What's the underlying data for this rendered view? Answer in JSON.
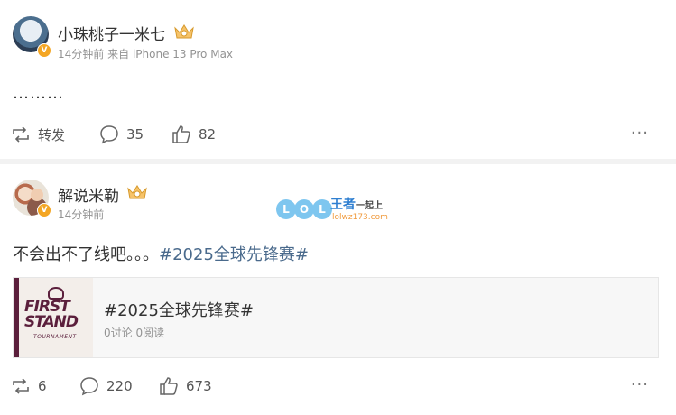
{
  "posts": [
    {
      "user": "小珠桃子一米七",
      "time": "14分钟前",
      "source_prefix": "来自",
      "source": "iPhone 13 Pro Max",
      "content": "………",
      "actions": {
        "repost_label": "转发",
        "comments": "35",
        "likes": "82"
      }
    },
    {
      "user": "解说米勒",
      "time": "14分钟前",
      "content": "不会出不了线吧。。。",
      "topic": "#2025全球先锋赛#",
      "card": {
        "thumb_title": "FIRST STAND",
        "thumb_subtitle": "TOURNAMENT",
        "title": "#2025全球先锋赛#",
        "stats": "0讨论 0阅读"
      },
      "actions": {
        "repost": "6",
        "comments": "220",
        "likes": "673"
      }
    }
  ],
  "watermark": {
    "lol": [
      "L",
      "O",
      "L"
    ],
    "cn_big": "王者",
    "cn_small": "一起上",
    "url": "lolwz173.com"
  },
  "more_label": "···",
  "verified_label": "V",
  "colors": {
    "topic": "#4a6a8c",
    "badge": "#f4a624",
    "meta": "#939393"
  }
}
